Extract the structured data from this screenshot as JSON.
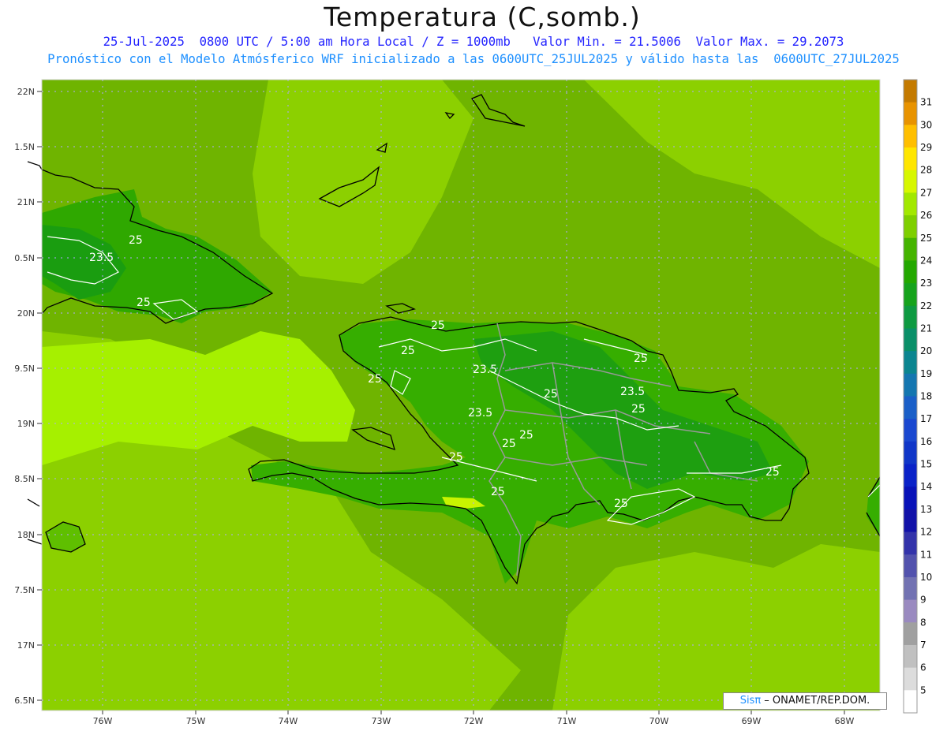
{
  "header": {
    "title": "Temperatura (C,somb.)",
    "subtitle1": "25-Jul-2025  0800 UTC / 5:00 am Hora Local / Z = 1000mb   Valor Min. = 21.5006  Valor Max. = 29.2073",
    "subtitle2": "Pronóstico con el Modelo Atmósferico WRF inicializado a las 0600UTC_25JUL2025 y válido hasta las  0600UTC_27JUL2025"
  },
  "map": {
    "lat_labels": [
      "22N",
      "1.5N",
      "21N",
      "0.5N",
      "20N",
      "9.5N",
      "19N",
      "8.5N",
      "18N",
      "7.5N",
      "17N",
      "6.5N"
    ],
    "lon_labels": [
      "76W",
      "75W",
      "74W",
      "73W",
      "72W",
      "71W",
      "70W",
      "69W",
      "68W"
    ],
    "contour_labels": [
      "25",
      "23.5",
      "25",
      "25",
      "25",
      "23.5",
      "25",
      "25",
      "23.5",
      "23.5",
      "25",
      "25",
      "25",
      "25",
      "25",
      "25",
      "25",
      "25"
    ]
  },
  "colorbar": {
    "levels": [
      "31",
      "30",
      "29",
      "28",
      "27",
      "26",
      "25",
      "24",
      "23",
      "22",
      "21",
      "20",
      "19",
      "18",
      "17",
      "16",
      "15",
      "14",
      "13",
      "12",
      "11",
      "10",
      "9",
      "8",
      "7",
      "6",
      "5"
    ],
    "colors": [
      "#c47a00",
      "#e89300",
      "#ffbf00",
      "#ffe600",
      "#d7f700",
      "#a2e800",
      "#7ecf00",
      "#45b400",
      "#23a800",
      "#16a31c",
      "#0e9a41",
      "#0a8f68",
      "#0b8590",
      "#1476b0",
      "#1a5fc8",
      "#1a48d0",
      "#1036c8",
      "#0a22c8",
      "#0812b8",
      "#1212a8",
      "#3333aa",
      "#5252ad",
      "#7272b2",
      "#9a8ac0",
      "#a0a0a0",
      "#c0c0c0",
      "#dcdcdc",
      "#ffffff"
    ]
  },
  "credit": {
    "sis": "Sisπ",
    "rest": " – ONAMET/REP.DOM."
  }
}
